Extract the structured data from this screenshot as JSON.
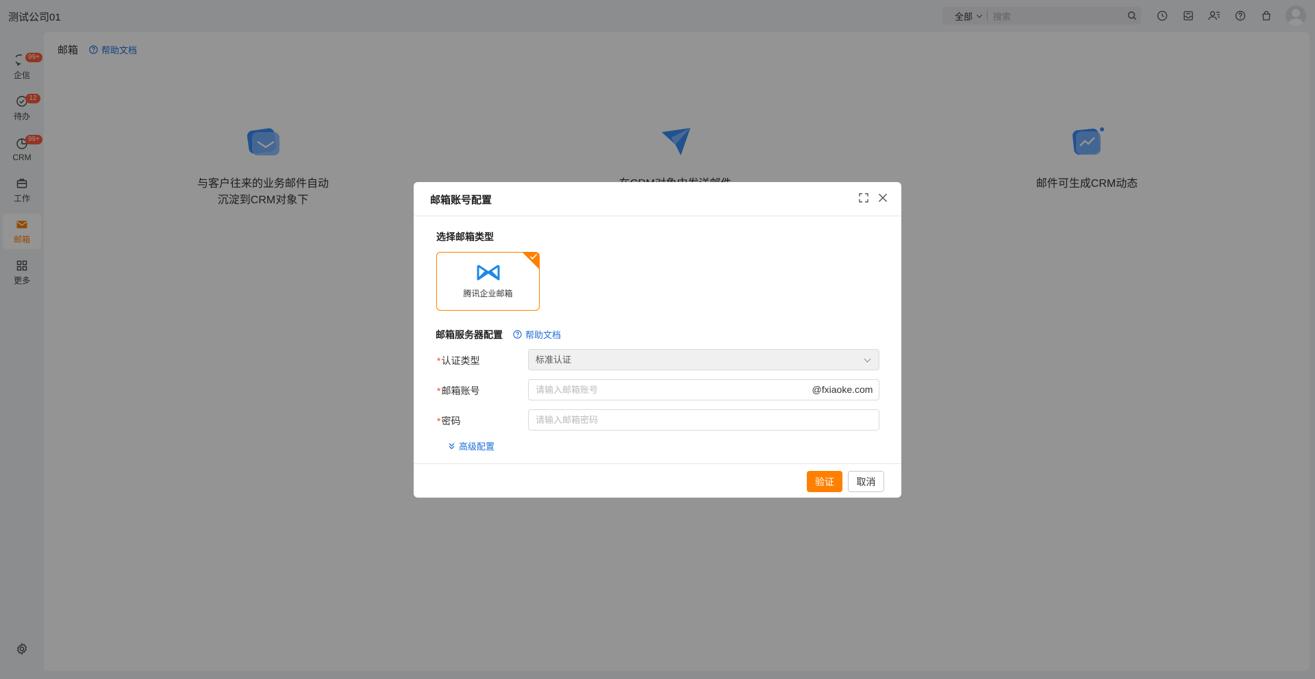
{
  "topbar": {
    "company": "测试公司01",
    "search_scope": "全部",
    "search_placeholder": "搜索",
    "icons": [
      "clock-icon",
      "inbox-icon",
      "contacts-icon",
      "help-icon",
      "bag-icon"
    ]
  },
  "sidebar": {
    "items": [
      {
        "label": "企信",
        "badge": "99+",
        "icon": "chat-icon"
      },
      {
        "label": "待办",
        "badge": "12",
        "icon": "check-circle-icon"
      },
      {
        "label": "CRM",
        "badge": "99+",
        "icon": "crm-icon"
      },
      {
        "label": "工作",
        "icon": "briefcase-icon"
      },
      {
        "label": "邮箱",
        "icon": "mail-icon",
        "active": true
      },
      {
        "label": "更多",
        "icon": "grid-icon"
      }
    ]
  },
  "main": {
    "title": "邮箱",
    "help_link": "帮助文档",
    "features": [
      {
        "line1": "与客户往来的业务邮件自动",
        "line2": "沉淀到CRM对象下"
      },
      {
        "line1": "在CRM对象中发送邮件",
        "line2": ""
      },
      {
        "line1": "邮件可生成CRM动态",
        "line2": ""
      }
    ]
  },
  "dialog": {
    "title": "邮箱账号配置",
    "section_type": "选择邮箱类型",
    "mail_type_label": "腾讯企业邮箱",
    "section_server": "邮箱服务器配置",
    "server_help": "帮助文档",
    "fields": {
      "auth_type_label": "认证类型",
      "auth_type_value": "标准认证",
      "account_label": "邮箱账号",
      "account_placeholder": "请输入邮箱账号",
      "account_suffix": "@fxiaoke.com",
      "password_label": "密码",
      "password_placeholder": "请输入邮箱密码",
      "required_mark": "*"
    },
    "advanced": "高级配置",
    "buttons": {
      "verify": "验证",
      "cancel": "取消"
    }
  },
  "colors": {
    "accent": "#ff8000",
    "link": "#1e6fd9",
    "badge": "#ff5a3c",
    "required": "#ff3b30"
  }
}
